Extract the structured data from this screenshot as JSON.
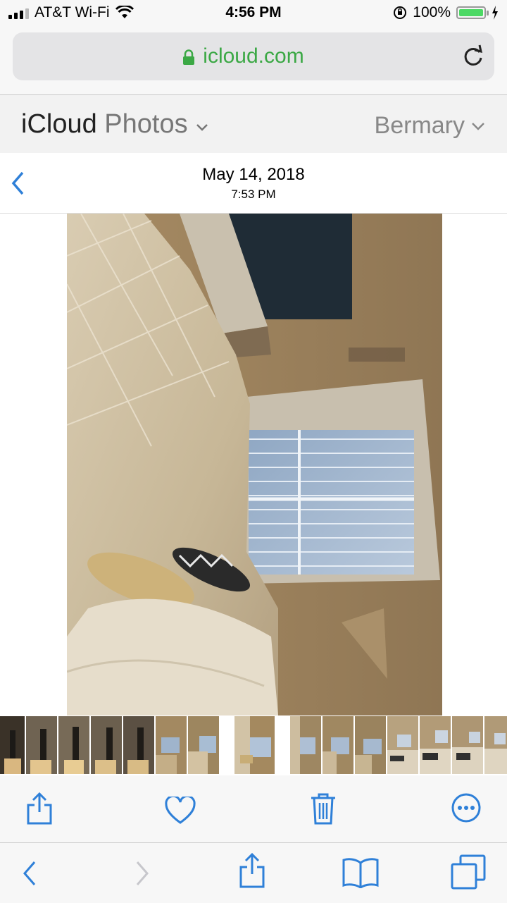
{
  "status_bar": {
    "carrier": "AT&T Wi-Fi",
    "time": "4:56 PM",
    "battery": "100%",
    "icons": [
      "signal-icon",
      "wifi-icon",
      "rotation-lock-icon",
      "battery-icon",
      "charging-icon"
    ]
  },
  "browser": {
    "url": "icloud.com",
    "secure_color": "#3ba845",
    "icons": [
      "lock-icon",
      "reload-icon"
    ]
  },
  "app_header": {
    "brand_icloud": "iCloud",
    "brand_photos": "Photos",
    "user_name": "Bermary",
    "icons": [
      "chevron-down-icon"
    ]
  },
  "photo_nav": {
    "date": "May 14, 2018",
    "time": "7:53 PM",
    "icons": [
      "back-chevron-icon"
    ]
  },
  "photo": {
    "icons": [
      "bedroom-photo"
    ]
  },
  "filmstrip": {
    "thumbnail_count": 16
  },
  "photo_toolbar": {
    "icons": [
      "share-icon",
      "heart-icon",
      "trash-icon",
      "more-icon"
    ],
    "accent": "#2f80d8"
  },
  "safari_toolbar": {
    "icons": [
      "back-icon",
      "forward-icon",
      "share-icon",
      "bookmarks-icon",
      "tabs-icon"
    ],
    "accent": "#2f80d8"
  }
}
